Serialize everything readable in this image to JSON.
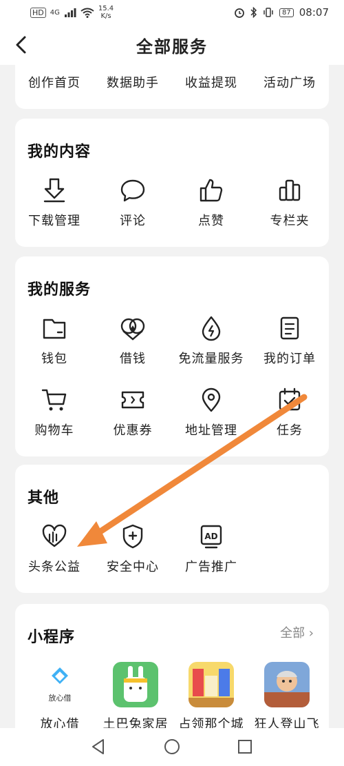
{
  "status": {
    "network_speed": "15.4",
    "speed_unit": "K/s",
    "network_type": "4G",
    "hd_badge": "HD",
    "battery": "87",
    "time": "08:07"
  },
  "header": {
    "title": "全部服务"
  },
  "top_row": [
    "创作首页",
    "数据助手",
    "收益提现",
    "活动广场"
  ],
  "my_content": {
    "title": "我的内容",
    "items": [
      "下载管理",
      "评论",
      "点赞",
      "专栏夹"
    ]
  },
  "my_services": {
    "title": "我的服务",
    "items": [
      "钱包",
      "借钱",
      "免流量服务",
      "我的订单",
      "购物车",
      "优惠券",
      "地址管理",
      "任务"
    ]
  },
  "other": {
    "title": "其他",
    "items": [
      "头条公益",
      "安全中心",
      "广告推广"
    ]
  },
  "mini_programs": {
    "title": "小程序",
    "more": "全部",
    "items": [
      "放心借",
      "土巴兔家居",
      "占领那个城",
      "狂人登山飞"
    ]
  },
  "annotation": {
    "arrow_color": "#f0883a"
  }
}
